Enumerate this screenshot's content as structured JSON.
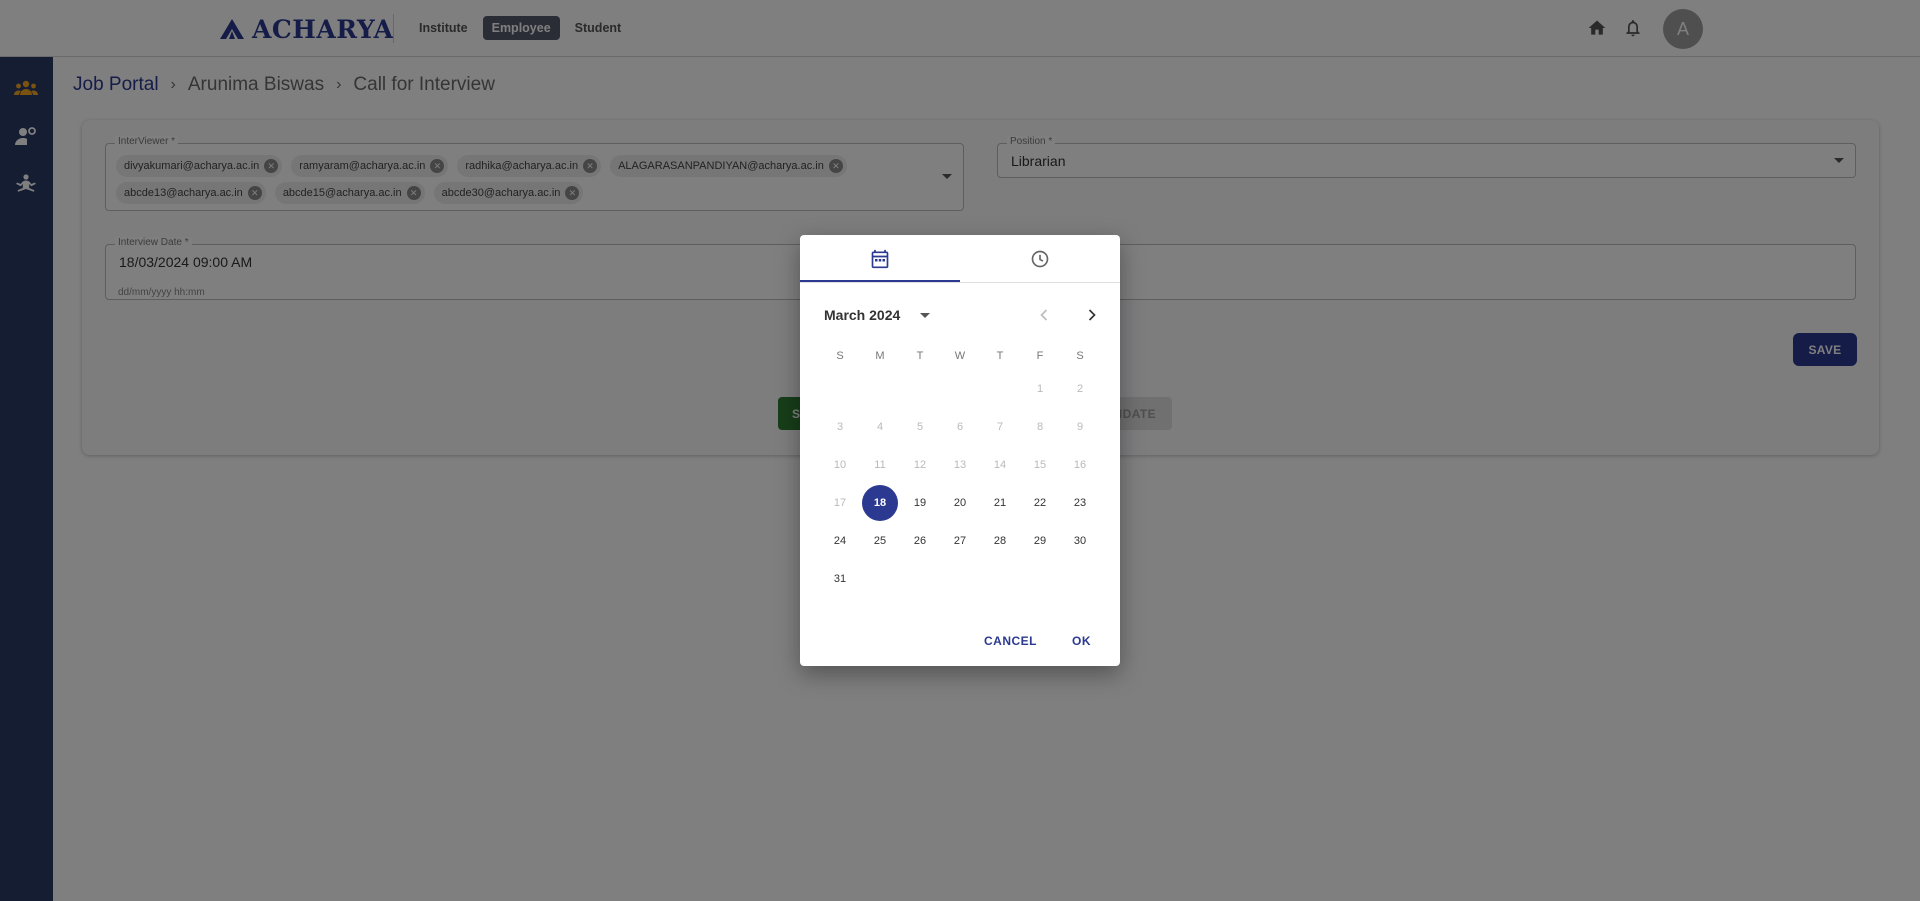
{
  "header": {
    "logo_text": "ACHARYA",
    "tabs": [
      {
        "label": "Institute",
        "active": false
      },
      {
        "label": "Employee",
        "active": true
      },
      {
        "label": "Student",
        "active": false
      }
    ],
    "avatar_initial": "A",
    "icons": [
      "home-icon",
      "bell-icon"
    ]
  },
  "sidebar": {
    "icons": [
      "users-group-icon",
      "user-settings-icon",
      "meditation-icon"
    ],
    "accent_color": "#f5a623"
  },
  "breadcrumb": {
    "items": [
      "Job Portal",
      "Arunima Biswas",
      "Call for Interview"
    ]
  },
  "form": {
    "interviewer": {
      "label": "InterViewer *",
      "chips": [
        "divyakumari@acharya.ac.in",
        "ramyaram@acharya.ac.in",
        "radhika@acharya.ac.in",
        "ALAGARASANPANDIYAN@acharya.ac.in",
        "abcde13@acharya.ac.in",
        "abcde15@acharya.ac.in",
        "abcde30@acharya.ac.in"
      ]
    },
    "position": {
      "label": "Position *",
      "value": "Librarian"
    },
    "interview_date": {
      "label": "Interview Date *",
      "value": "18/03/2024 09:00 AM",
      "helper": "dd/mm/yyyy hh:mm"
    },
    "save_label": "SAVE",
    "green_button_label": "S",
    "grey_button_label": "IDATE"
  },
  "datepicker": {
    "month_label": "March 2024",
    "weekdays": [
      "S",
      "M",
      "T",
      "W",
      "T",
      "F",
      "S"
    ],
    "first_weekday_index": 5,
    "days_in_month": 31,
    "selected_day": 18,
    "disabled_before": 18,
    "cancel_label": "CANCEL",
    "ok_label": "OK",
    "tabs": [
      "calendar-icon",
      "clock-icon"
    ],
    "accent_color": "#2b3990"
  }
}
